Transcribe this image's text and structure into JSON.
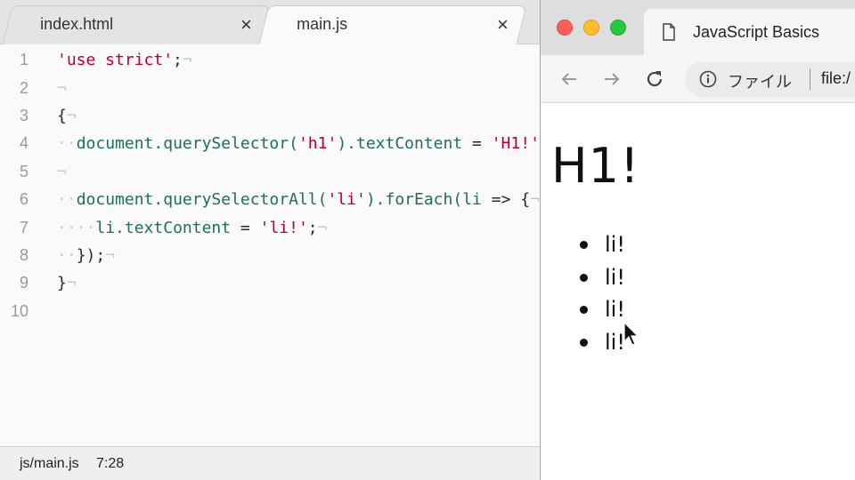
{
  "editor": {
    "tabs": [
      {
        "label": "index.html",
        "close": "×",
        "active": false
      },
      {
        "label": "main.js",
        "close": "×",
        "active": true
      }
    ],
    "lines": [
      {
        "num": "1"
      },
      {
        "num": "2"
      },
      {
        "num": "3"
      },
      {
        "num": "4"
      },
      {
        "num": "5"
      },
      {
        "num": "6"
      },
      {
        "num": "7"
      },
      {
        "num": "8"
      },
      {
        "num": "9"
      },
      {
        "num": "10"
      }
    ],
    "code": {
      "l1_str": "'use strict'",
      "l1_end": ";",
      "l4_obj": "document",
      "l4_method": ".querySelector(",
      "l4_arg": "'h1'",
      "l4_prop": ").textContent",
      "l4_eq": " = ",
      "l4_val": "'H1!'",
      "l4_end": ";",
      "l6_obj": "document",
      "l6_method": ".querySelectorAll(",
      "l6_arg": "'li'",
      "l6_call": ").forEach(",
      "l6_param": "li",
      "l6_arrow": " => {",
      "l7_obj": "li",
      "l7_prop": ".textContent",
      "l7_eq": " = ",
      "l7_val": "'li!'",
      "l7_end": ";",
      "l8": "});",
      "l3": "{",
      "l9": "}",
      "pilcrow": "¬"
    },
    "status": {
      "path": "js/main.js",
      "position": "7:28"
    }
  },
  "browser": {
    "tab_title": "JavaScript Basics",
    "omnibox_label": "ファイル",
    "omnibox_url": "file:/",
    "page": {
      "h1": "H1!",
      "items": [
        "li!",
        "li!",
        "li!",
        "li!"
      ]
    }
  },
  "colors": {
    "string": "#b8002f",
    "identifier": "#1f6d5a",
    "traffic_red": "#fc5f57",
    "traffic_yellow": "#fdbc2e",
    "traffic_green": "#28c840"
  }
}
